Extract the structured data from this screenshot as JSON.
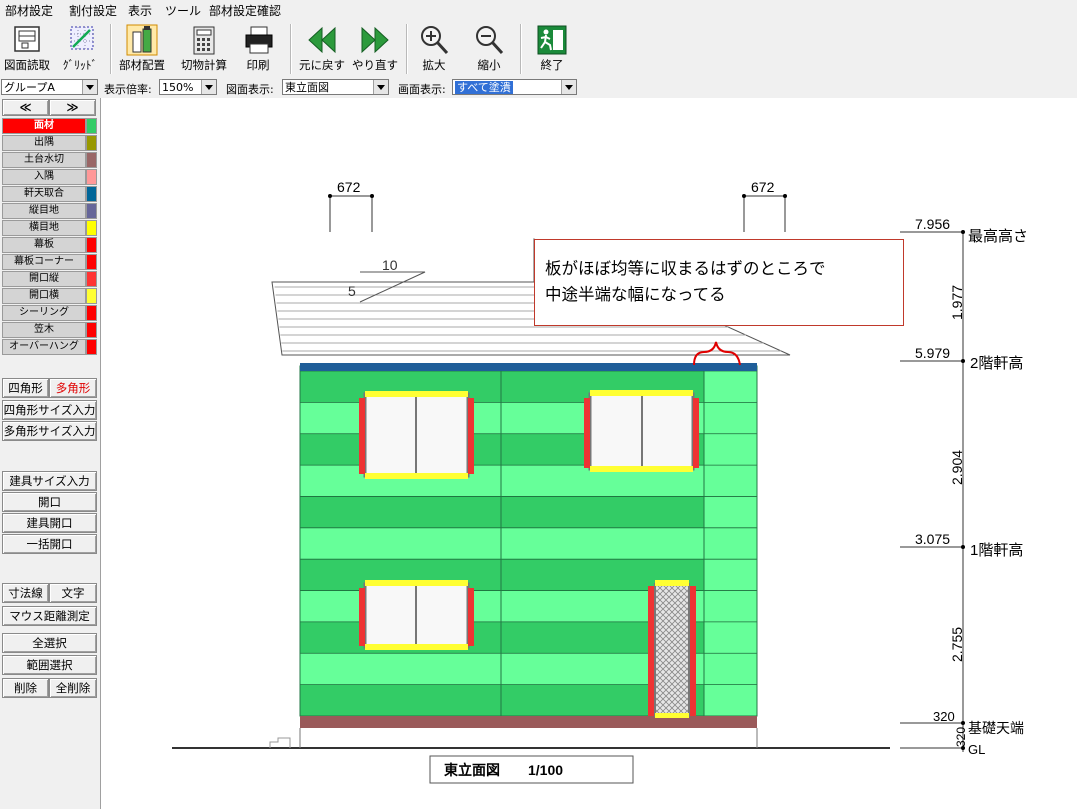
{
  "menu": [
    "部材設定",
    "割付設定",
    "表示",
    "ツール",
    "部材設定確認"
  ],
  "toolbar": {
    "read_drawing": "図面読取",
    "grid": "ｸﾞﾘｯﾄﾞ",
    "place_parts": "部材配置",
    "cut_calc": "切物計算",
    "print": "印刷",
    "undo": "元に戻す",
    "redo": "やり直す",
    "zoom_in": "拡大",
    "zoom_out": "縮小",
    "exit": "終了"
  },
  "options": {
    "group": "グループA",
    "scale_label": "表示倍率:",
    "scale_value": "150%",
    "drawing_label": "図面表示:",
    "drawing_value": "東立面図",
    "screen_label": "画面表示:",
    "screen_value": "すべて塗潰"
  },
  "panel": {
    "prev": "≪",
    "next": "≫",
    "materials": [
      {
        "label": "面材",
        "color": "#ff0000",
        "swatch": "#33cc66",
        "active": true
      },
      {
        "label": "出隅",
        "color": "#d4d4d4",
        "swatch": "#999900"
      },
      {
        "label": "土台水切",
        "color": "#d4d4d4",
        "swatch": "#996666"
      },
      {
        "label": "入隅",
        "color": "#d4d4d4",
        "swatch": "#ff9999"
      },
      {
        "label": "軒天取合",
        "color": "#d4d4d4",
        "swatch": "#006699"
      },
      {
        "label": "縦目地",
        "color": "#d4d4d4",
        "swatch": "#666699"
      },
      {
        "label": "横目地",
        "color": "#d4d4d4",
        "swatch": "#ffff00"
      },
      {
        "label": "幕板",
        "color": "#d4d4d4",
        "swatch": "#ff0000"
      },
      {
        "label": "幕板コーナー",
        "color": "#d4d4d4",
        "swatch": "#ff0000"
      },
      {
        "label": "開口縦",
        "color": "#d4d4d4",
        "swatch": "#ff3333"
      },
      {
        "label": "開口横",
        "color": "#d4d4d4",
        "swatch": "#ffff33"
      },
      {
        "label": "シーリング",
        "color": "#d4d4d4",
        "swatch": "#ff0000"
      },
      {
        "label": "笠木",
        "color": "#d4d4d4",
        "swatch": "#ff0000"
      },
      {
        "label": "オーバーハング",
        "color": "#d4d4d4",
        "swatch": "#ff0000"
      }
    ],
    "rect": "四角形",
    "poly": "多角形",
    "rect_size": "四角形サイズ入力",
    "poly_size": "多角形サイズ入力",
    "fitting_size": "建具サイズ入力",
    "opening": "開口",
    "fitting_opening": "建具開口",
    "bulk_opening": "一括開口",
    "dimension": "寸法線",
    "text": "文字",
    "mouse_distance": "マウス距離測定",
    "select_all": "全選択",
    "range_select": "範囲選択",
    "delete": "削除",
    "delete_all": "全削除"
  },
  "drawing": {
    "dim_left": "672",
    "dim_right": "672",
    "roof_slope_run": "10",
    "roof_slope_rise": "5",
    "levels": [
      {
        "value": "7.956",
        "label": "最高高さ"
      },
      {
        "value": "5.979",
        "label": "2階軒高"
      },
      {
        "value": "3.075",
        "label": "1階軒高"
      },
      {
        "value": "320",
        "label": "基礎天端"
      },
      {
        "value": "320",
        "label": "GL"
      }
    ],
    "spans": [
      "1.977",
      "2.904",
      "2.755"
    ],
    "title": "東立面図　　1/100"
  },
  "callout": {
    "line1": "板がほぼ均等に収まるはずのところで",
    "line2": "中途半端な幅になってる"
  }
}
